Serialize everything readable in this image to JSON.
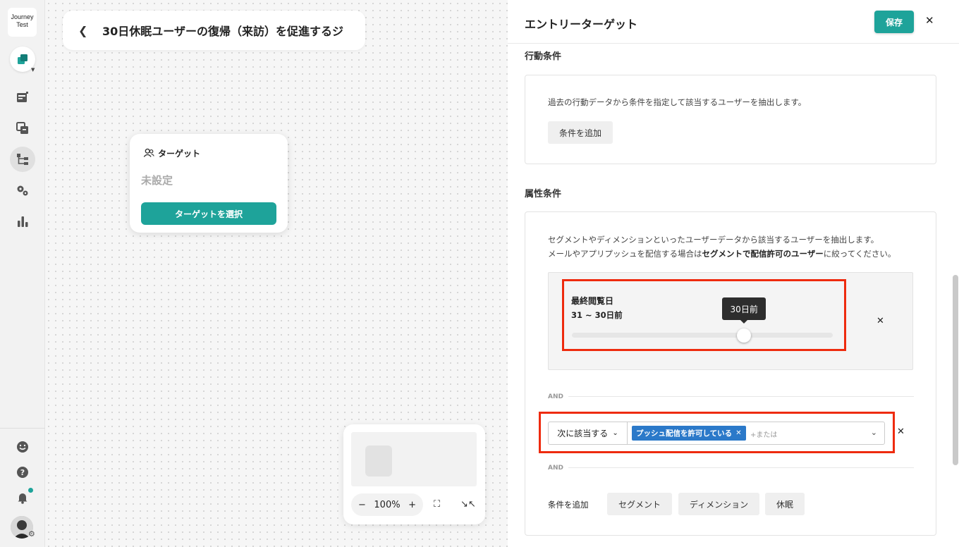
{
  "app": {
    "logo_line1": "Journey",
    "logo_line2": "Test"
  },
  "rail": {
    "items": [
      "home-icon",
      "newspaper-icon",
      "copy-icon",
      "flow-icon",
      "gears-icon",
      "bar-chart-icon"
    ],
    "bottom": [
      "smile-icon",
      "help-icon",
      "bell-icon",
      "avatar"
    ]
  },
  "canvas": {
    "title": "30日休眠ユーザーの復帰（来訪）を促進するジ",
    "target_node": {
      "header": "ターゲット",
      "status": "未設定",
      "button": "ターゲットを選択"
    },
    "zoom": {
      "minus": "−",
      "level": "100%",
      "plus": "+"
    }
  },
  "panel": {
    "title": "エントリーターゲット",
    "save": "保存",
    "behavior": {
      "label": "行動条件",
      "desc": "過去の行動データから条件を指定して該当するユーザーを抽出します。",
      "add_button": "条件を追加"
    },
    "attribute": {
      "label": "属性条件",
      "desc_line1": "セグメントやディメンションといったユーザーデータから該当するユーザーを抽出します。",
      "desc_line2_pre": "メールやアプリプッシュを配信する場合は",
      "desc_line2_bold": "セグメントで配信許可のユーザー",
      "desc_line2_post": "に絞ってください。",
      "condition": {
        "name": "最終閲覧日",
        "range": "31 ~ 30日前",
        "tooltip": "30日前",
        "slider_fraction": 0.66
      },
      "and1": "AND",
      "segment_rule": {
        "mode": "次に該当する",
        "chip": "プッシュ配信を許可している",
        "placeholder": "+または"
      },
      "and2": "AND",
      "add_label": "条件を追加",
      "add_options": [
        "セグメント",
        "ディメンション",
        "休眠"
      ]
    }
  },
  "colors": {
    "accent": "#1ea39a",
    "chip": "#2b79c9",
    "highlight": "#ee2b0e"
  }
}
